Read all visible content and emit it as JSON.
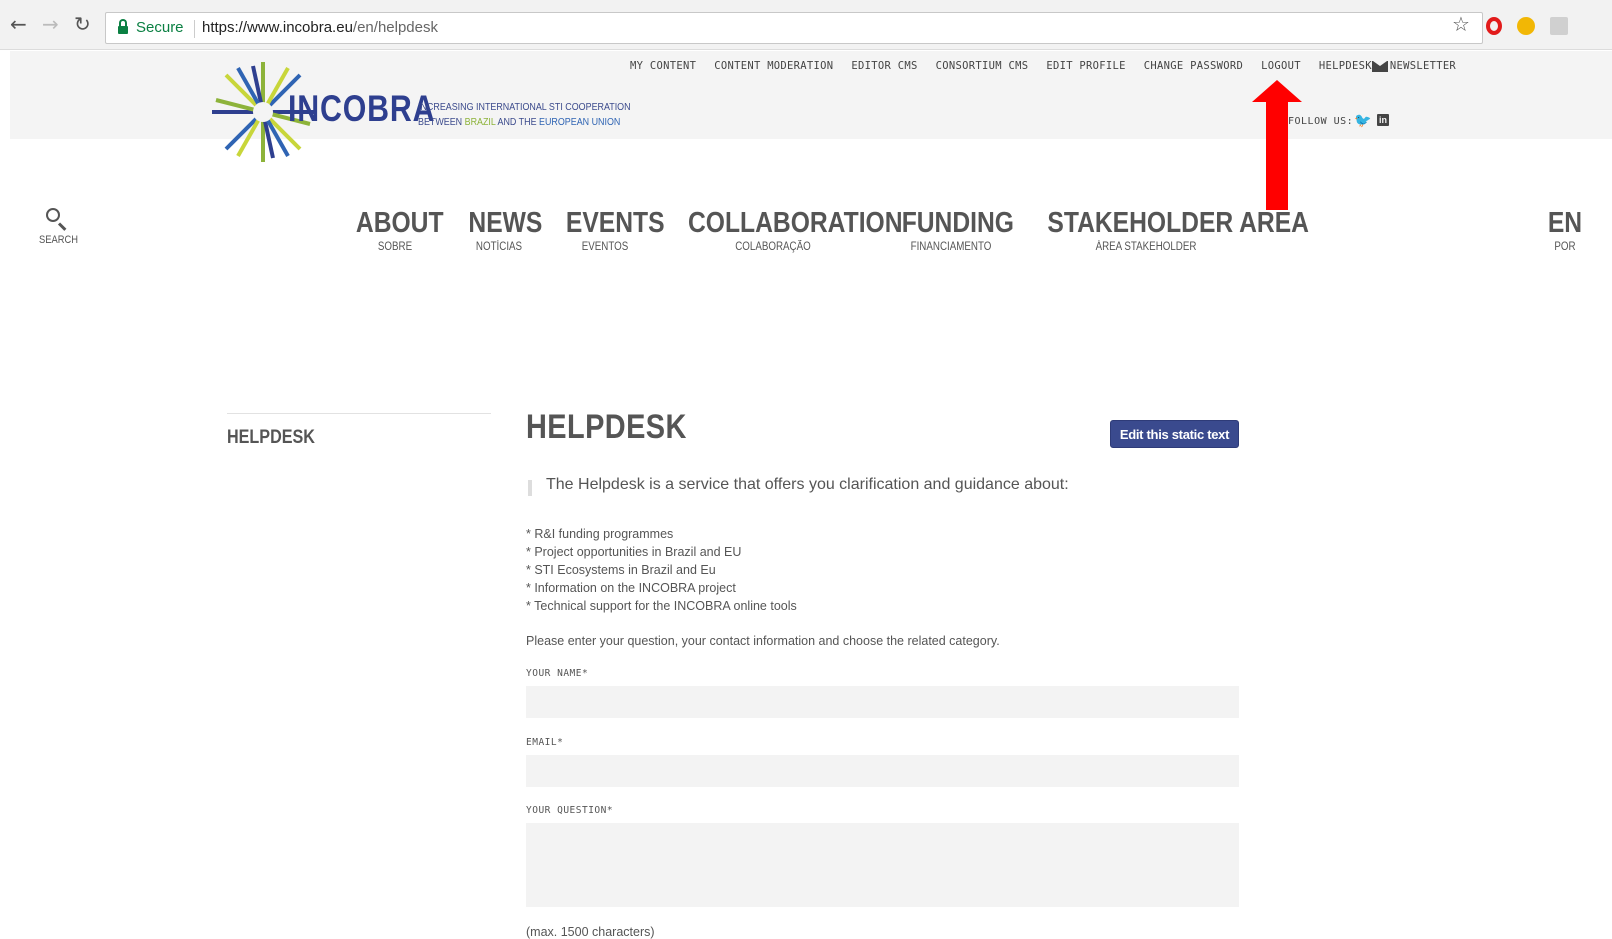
{
  "browser": {
    "secure_label": "Secure",
    "url_host": "https://www.incobra.eu",
    "url_path": "/en/helpdesk"
  },
  "site": {
    "logo_word": "INCOBRA",
    "tagline_line1": "INCREASING INTERNATIONAL STI COOPERATION",
    "tagline_between": "BETWEEN ",
    "tagline_brazil": "BRAZIL",
    "tagline_and": " AND THE ",
    "tagline_eu": "EUROPEAN UNION",
    "follow_label": "FOLLOW US:",
    "colors": {
      "brand_blue": "#2e3f8f",
      "brand_green": "#8db33a",
      "button": "#3a4a8e",
      "arrow": "#ff0000"
    }
  },
  "top_links": [
    "MY CONTENT",
    "CONTENT MODERATION",
    "EDITOR CMS",
    "CONSORTIUM CMS",
    "EDIT PROFILE",
    "CHANGE PASSWORD",
    "LOGOUT",
    "HELPDESK",
    "NEWSLETTER"
  ],
  "search_label": "SEARCH",
  "main_nav": [
    {
      "label": "ABOUT",
      "sub": "SOBRE"
    },
    {
      "label": "NEWS",
      "sub": "NOTÍCIAS"
    },
    {
      "label": "EVENTS",
      "sub": "EVENTOS"
    },
    {
      "label": "COLLABORATION",
      "sub": "COLABORAÇÃO"
    },
    {
      "label": "FUNDING",
      "sub": "FINANCIAMENTO"
    },
    {
      "label": "STAKEHOLDER AREA",
      "sub": "ÁREA STAKEHOLDER"
    }
  ],
  "lang": {
    "current": "EN",
    "other": "POR"
  },
  "sidebar_title": "HELPDESK",
  "page_title": "HELPDESK",
  "edit_button": "Edit this static text",
  "intro": "The Helpdesk is a service that offers you clarification and guidance about:",
  "bullets": [
    "* R&I funding programmes",
    "* Project opportunities in Brazil and EU",
    "* STI Ecosystems in Brazil and Eu",
    "* Information on the INCOBRA project",
    "* Technical support for the INCOBRA online tools"
  ],
  "instruction": "Please enter your question, your contact information and choose the related category.",
  "form": {
    "name_label": "YOUR NAME*",
    "name_value": "",
    "email_label": "EMAIL*",
    "email_value": "",
    "question_label": "YOUR QUESTION*",
    "question_value": "",
    "max_note": "(max. 1500 characters)"
  }
}
